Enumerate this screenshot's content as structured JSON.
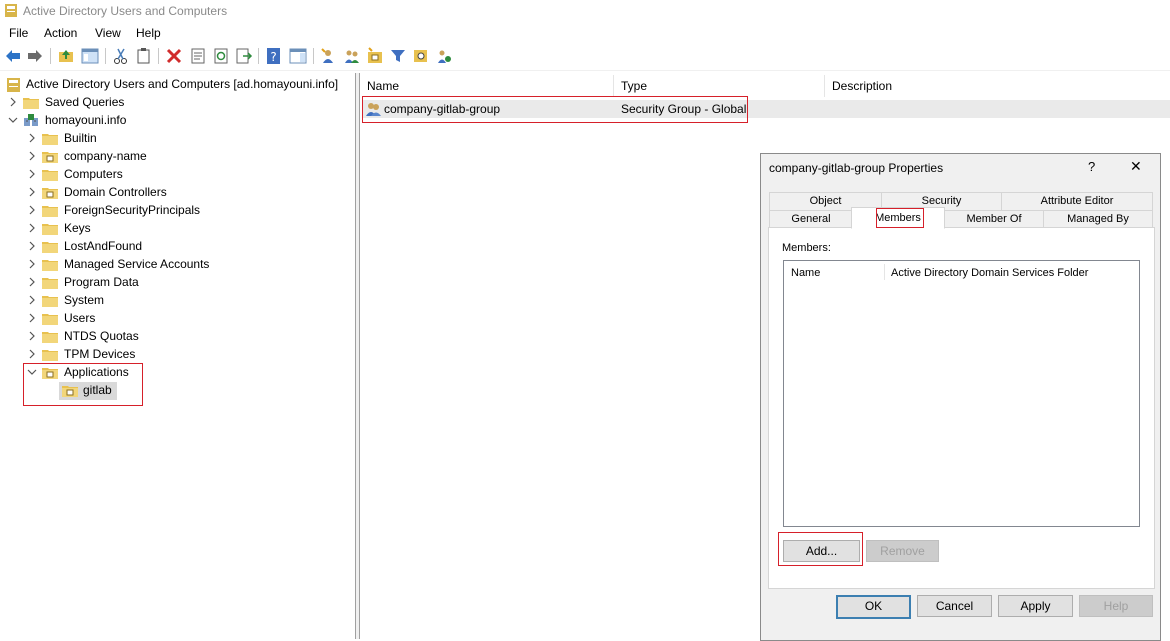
{
  "window": {
    "title": "Active Directory Users and Computers"
  },
  "menu": [
    "File",
    "Action",
    "View",
    "Help"
  ],
  "tree": {
    "root": "Active Directory Users and Computers [ad.homayouni.info]",
    "saved_queries": "Saved Queries",
    "domain": "homayouni.info",
    "children": [
      "Builtin",
      "company-name",
      "Computers",
      "Domain Controllers",
      "ForeignSecurityPrincipals",
      "Keys",
      "LostAndFound",
      "Managed Service Accounts",
      "Program Data",
      "System",
      "Users",
      "NTDS Quotas",
      "TPM Devices"
    ],
    "applications": "Applications",
    "applications_child": "gitlab"
  },
  "list": {
    "columns": [
      "Name",
      "Type",
      "Description"
    ],
    "rows": [
      {
        "name": "company-gitlab-group",
        "type": "Security Group - Global",
        "description": ""
      }
    ]
  },
  "dialog": {
    "title": "company-gitlab-group Properties",
    "help_glyph": "?",
    "close_glyph": "✕",
    "tabs_top": [
      "Object",
      "Security",
      "Attribute Editor"
    ],
    "tabs_bottom": [
      "General",
      "Members",
      "Member Of",
      "Managed By"
    ],
    "members_label": "Members:",
    "members_columns": [
      "Name",
      "Active Directory Domain Services Folder"
    ],
    "add_label": "Add...",
    "remove_label": "Remove",
    "ok_label": "OK",
    "cancel_label": "Cancel",
    "apply_label": "Apply",
    "help_label": "Help"
  },
  "colors": {
    "accent": "#3c7fb1",
    "highlight": "#d6202a",
    "folder": "#e8c14f"
  }
}
